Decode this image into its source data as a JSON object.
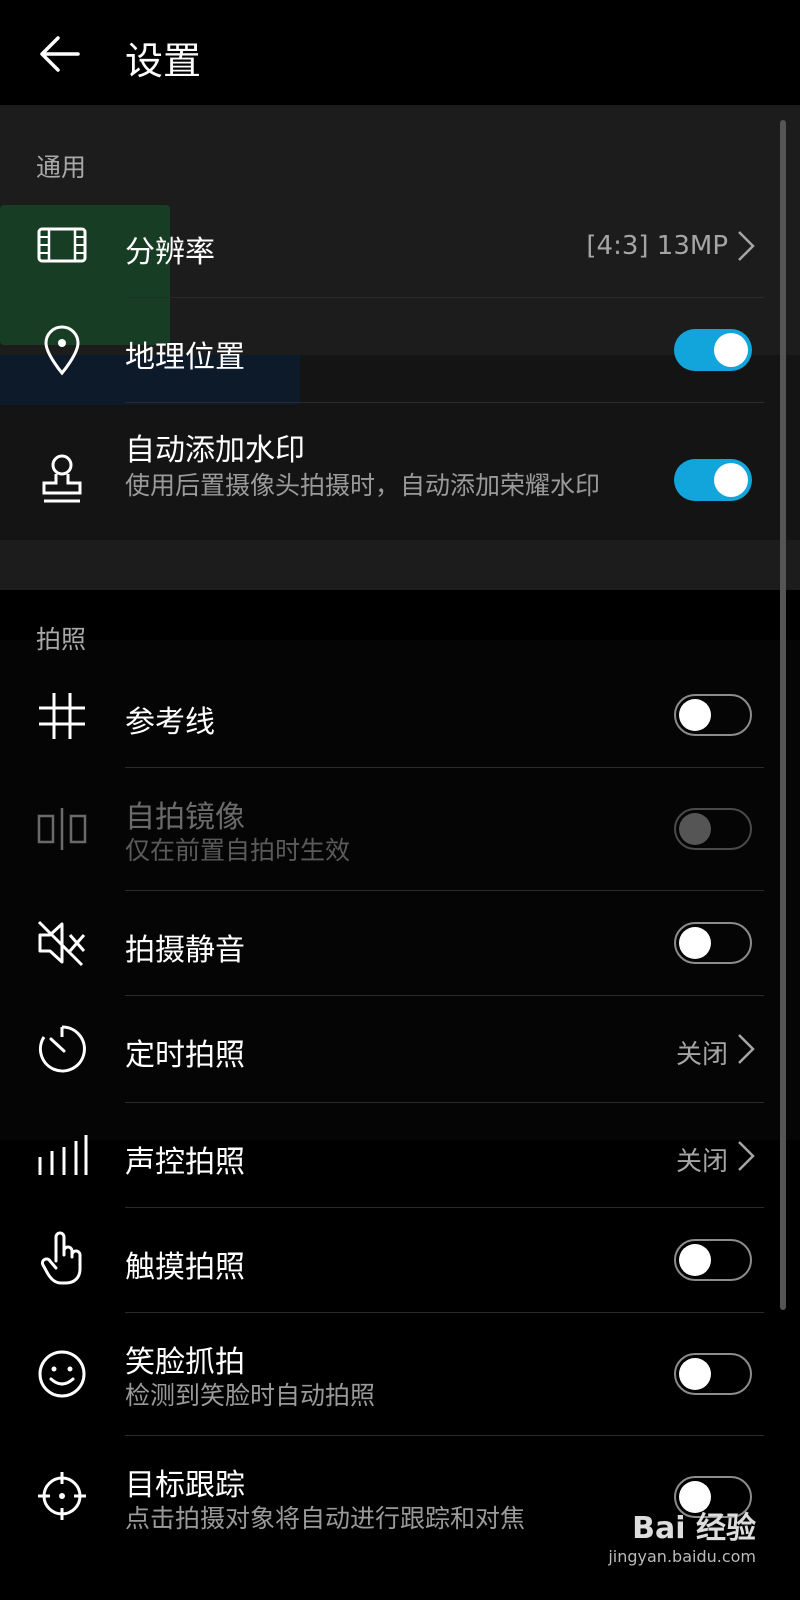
{
  "header": {
    "title": "设置"
  },
  "sections": {
    "general": {
      "title": "通用"
    },
    "photo": {
      "title": "拍照"
    }
  },
  "settings": {
    "resolution": {
      "label": "分辨率",
      "value": "[4:3] 13MP"
    },
    "location": {
      "label": "地理位置",
      "state": "on"
    },
    "watermark": {
      "label": "自动添加水印",
      "desc": "使用后置摄像头拍摄时，自动添加荣耀水印",
      "state": "on"
    },
    "gridlines": {
      "label": "参考线",
      "state": "off"
    },
    "mirror": {
      "label": "自拍镜像",
      "desc": "仅在前置自拍时生效",
      "state": "off-disabled"
    },
    "mute": {
      "label": "拍摄静音",
      "state": "off"
    },
    "timer": {
      "label": "定时拍照",
      "value": "关闭"
    },
    "voice": {
      "label": "声控拍照",
      "value": "关闭"
    },
    "touch": {
      "label": "触摸拍照",
      "state": "off"
    },
    "smile": {
      "label": "笑脸抓拍",
      "desc": "检测到笑脸时自动拍照",
      "state": "off"
    },
    "tracking": {
      "label": "目标跟踪",
      "desc": "点击拍摄对象将自动进行跟踪和对焦",
      "state": "off"
    }
  },
  "watermark_overlay": {
    "main": "Bai 经验",
    "sub": "jingyan.baidu.com"
  },
  "colors": {
    "accent": "#12a5dc",
    "background": "#000000"
  }
}
